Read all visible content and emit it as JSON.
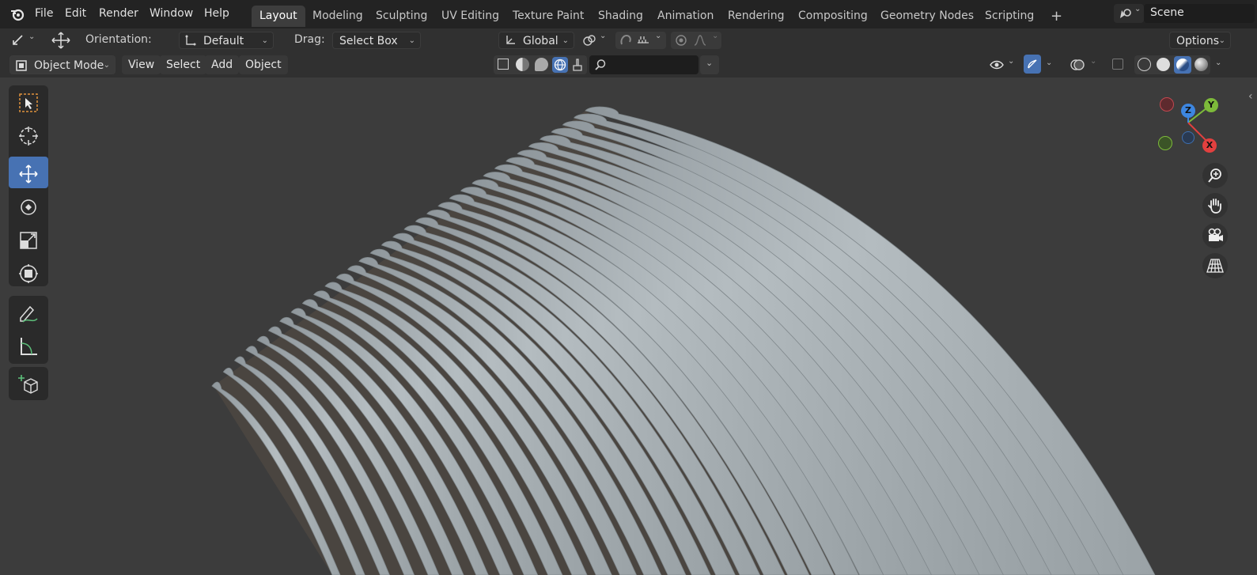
{
  "menu": {
    "file": "File",
    "edit": "Edit",
    "render": "Render",
    "window": "Window",
    "help": "Help"
  },
  "workspaces": [
    "Layout",
    "Modeling",
    "Sculpting",
    "UV Editing",
    "Texture Paint",
    "Shading",
    "Animation",
    "Rendering",
    "Compositing",
    "Geometry Nodes",
    "Scripting"
  ],
  "workspace_add": "+",
  "scene": {
    "name": "Scene"
  },
  "tool_header": {
    "orientation_label": "Orientation:",
    "orientation_value": "Default",
    "drag_label": "Drag:",
    "drag_value": "Select Box",
    "transform_orientation": "Global",
    "options_label": "Options"
  },
  "viewport_header": {
    "mode": "Object Mode",
    "view": "View",
    "select": "Select",
    "add": "Add",
    "object": "Object",
    "search_value": ""
  },
  "gizmo": {
    "z": "Z",
    "y": "Y",
    "x": "X"
  },
  "colors": {
    "accent": "#4772b3",
    "x_axis": "#e2403f",
    "y_axis": "#7dba3a",
    "z_axis": "#3d86e0",
    "bg": "#303030"
  },
  "icons": [
    "blender-logo-icon",
    "scene-icon",
    "select-box-icon",
    "cursor-icon",
    "move-icon",
    "rotate-icon",
    "scale-icon",
    "transform-icon",
    "annotate-icon",
    "measure-icon",
    "add-cube-icon",
    "zoom-icon",
    "hand-pan-icon",
    "camera-view-icon",
    "perspective-grid-icon"
  ]
}
